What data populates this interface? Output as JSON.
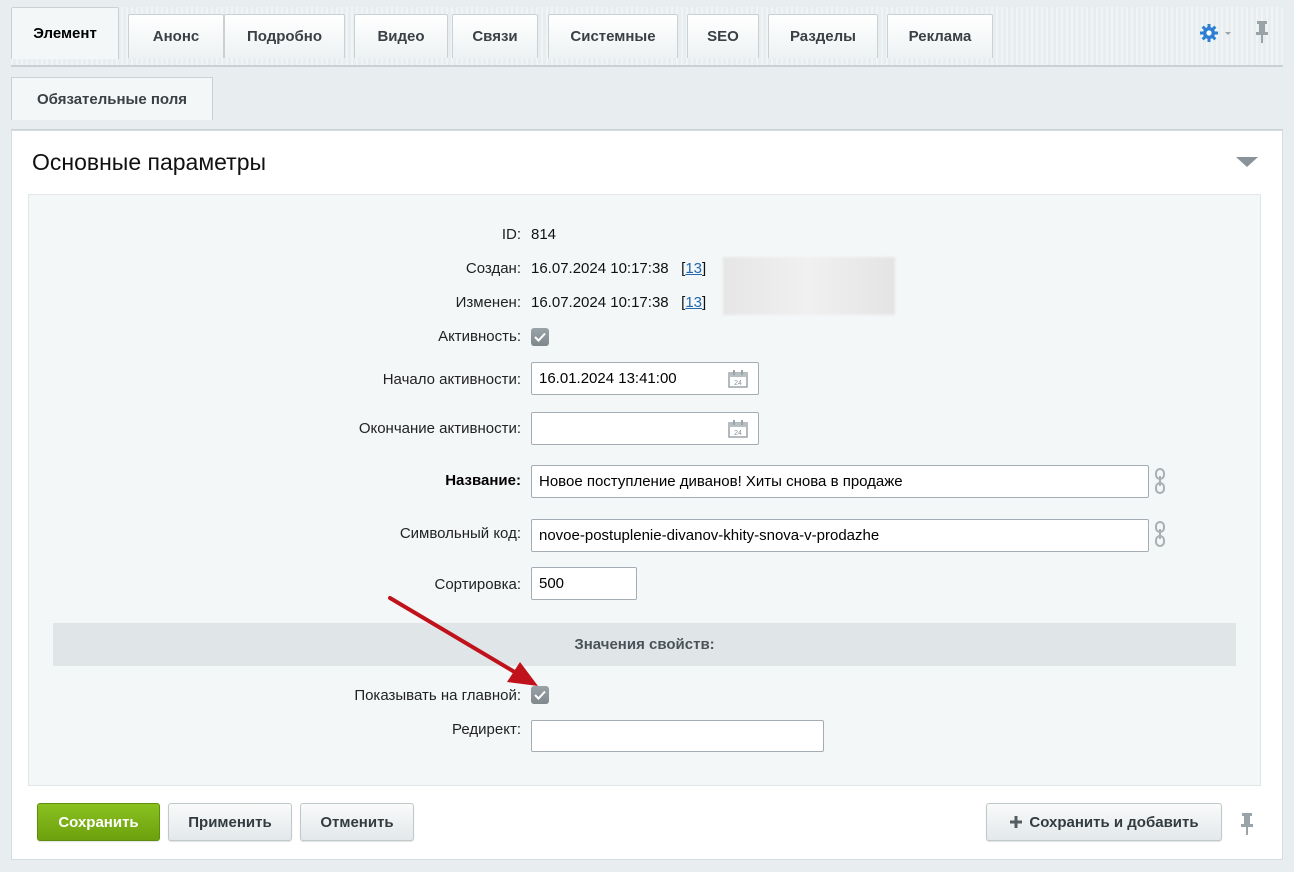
{
  "tabs": [
    "Элемент",
    "Анонс",
    "Подробно",
    "Видео",
    "Связи",
    "Системные",
    "SEO",
    "Разделы",
    "Реклама"
  ],
  "subtabs": [
    "Обязательные поля"
  ],
  "section": {
    "title": "Основные параметры"
  },
  "fields": {
    "id_label": "ID:",
    "id_value": "814",
    "created_label": "Создан:",
    "created_value": "16.07.2024 10:17:38",
    "created_user_id": "13",
    "modified_label": "Изменен:",
    "modified_value": "16.07.2024 10:17:38",
    "modified_user_id": "13",
    "active_label": "Активность:",
    "active_checked": true,
    "active_from_label": "Начало активности:",
    "active_from_value": "16.01.2024 13:41:00",
    "active_to_label": "Окончание активности:",
    "active_to_value": "",
    "name_label": "Название:",
    "name_value": "Новое поступление диванов! Хиты снова в продаже",
    "code_label": "Символьный код:",
    "code_value": "novoe-postuplenie-divanov-khity-snova-v-prodazhe",
    "sort_label": "Сортировка:",
    "sort_value": "500"
  },
  "properties": {
    "header": "Значения свойств:",
    "show_main_label": "Показывать на главной:",
    "show_main_checked": true,
    "redirect_label": "Редирект:",
    "redirect_value": ""
  },
  "buttons": {
    "save": "Сохранить",
    "apply": "Применить",
    "cancel": "Отменить",
    "save_and_add": "Сохранить и добавить"
  },
  "icons": {
    "settings": "gear-icon",
    "pin": "pin-icon",
    "calendar": "calendar-icon",
    "link": "chain-link-icon",
    "collapse": "triangle-down-icon",
    "add": "plus-icon"
  },
  "colors": {
    "primary_button": "#7ab317",
    "link": "#2067b0",
    "annotation_arrow": "#c0121b",
    "settings_icon": "#2d7fd3"
  }
}
